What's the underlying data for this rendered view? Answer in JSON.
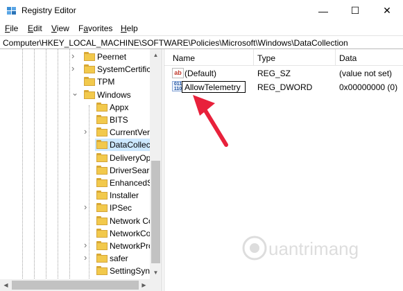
{
  "window": {
    "title": "Registry Editor",
    "minimize_glyph": "—",
    "maximize_glyph": "☐",
    "close_glyph": "✕"
  },
  "menu": [
    {
      "label": "File",
      "mnemonic": "F",
      "rest": "ile"
    },
    {
      "label": "Edit",
      "mnemonic": "E",
      "rest": "dit"
    },
    {
      "label": "View",
      "mnemonic": "V",
      "rest": "iew"
    },
    {
      "label": "Favorites",
      "mnemonic": "a",
      "pre": "F",
      "rest": "vorites"
    },
    {
      "label": "Help",
      "mnemonic": "H",
      "rest": "elp"
    }
  ],
  "address": "Computer\\HKEY_LOCAL_MACHINE\\SOFTWARE\\Policies\\Microsoft\\Windows\\DataCollection",
  "tree": {
    "items": [
      {
        "label": "Peernet",
        "expandable": true,
        "expanded": false,
        "level": 1
      },
      {
        "label": "SystemCertific",
        "expandable": true,
        "expanded": false,
        "level": 1
      },
      {
        "label": "TPM",
        "expandable": false,
        "expanded": false,
        "level": 1
      },
      {
        "label": "Windows",
        "expandable": true,
        "expanded": true,
        "level": 1
      },
      {
        "label": "Appx",
        "expandable": false,
        "level": 2
      },
      {
        "label": "BITS",
        "expandable": false,
        "level": 2
      },
      {
        "label": "CurrentVers",
        "expandable": true,
        "level": 2
      },
      {
        "label": "DataCollec",
        "expandable": false,
        "level": 2,
        "selected": true
      },
      {
        "label": "DeliveryOp",
        "expandable": false,
        "level": 2
      },
      {
        "label": "DriverSearc",
        "expandable": false,
        "level": 2
      },
      {
        "label": "EnhancedS",
        "expandable": false,
        "level": 2
      },
      {
        "label": "Installer",
        "expandable": false,
        "level": 2
      },
      {
        "label": "IPSec",
        "expandable": true,
        "level": 2
      },
      {
        "label": "Network Co",
        "expandable": false,
        "level": 2
      },
      {
        "label": "NetworkCo",
        "expandable": false,
        "level": 2
      },
      {
        "label": "NetworkPro",
        "expandable": true,
        "level": 2
      },
      {
        "label": "safer",
        "expandable": true,
        "level": 2
      },
      {
        "label": "SettingSyn",
        "expandable": false,
        "level": 2
      }
    ]
  },
  "list": {
    "columns": [
      "Name",
      "Type",
      "Data"
    ],
    "rows": [
      {
        "icon": "string-value-icon",
        "icon_text": "ab",
        "name": "(Default)",
        "type": "REG_SZ",
        "data": "(value not set)"
      },
      {
        "icon": "binary-value-icon",
        "icon_text": "011\n110",
        "name": "AllowTelemetry",
        "type": "REG_DWORD",
        "data": "0x00000000 (0)",
        "renaming": true
      }
    ]
  },
  "colors": {
    "selection": "#cce8ff",
    "folder": "#f2c94c",
    "arrow": "#e8213b"
  },
  "watermark": "uantrimang"
}
